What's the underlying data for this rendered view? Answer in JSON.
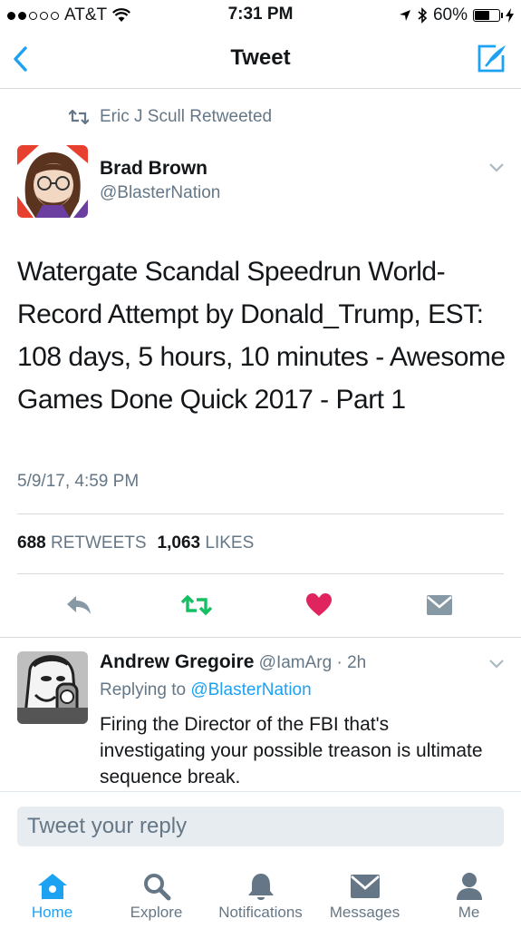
{
  "status_bar": {
    "carrier": "AT&T",
    "time": "7:31 PM",
    "battery": "60%",
    "battery_level": 0.6
  },
  "nav": {
    "title": "Tweet"
  },
  "tweet": {
    "retweeted_by": "Eric J Scull Retweeted",
    "author_name": "Brad Brown",
    "author_handle": "@BlasterNation",
    "text": "Watergate Scandal Speedrun World-Record Attempt by Donald_Trump, EST: 108 days, 5 hours, 10 minutes - Awesome Games Done Quick 2017 - Part 1",
    "timestamp": "5/9/17, 4:59 PM",
    "retweets_count": "688",
    "retweets_label": "RETWEETS",
    "likes_count": "1,063",
    "likes_label": "LIKES",
    "colors": {
      "retweet": "#17bf63",
      "like": "#e0245e",
      "action_gray": "#8899a6"
    }
  },
  "reply": {
    "author_name": "Andrew Gregoire",
    "author_handle": "@IamArg",
    "time": "· 2h",
    "replying_prefix": "Replying to",
    "replying_to": "@BlasterNation",
    "text": "Firing the Director of the FBI that's investigating your possible treason is ultimate sequence break."
  },
  "reply_box": {
    "placeholder": "Tweet your reply"
  },
  "tabs": [
    {
      "label": "Home",
      "icon": "home-icon",
      "active": true
    },
    {
      "label": "Explore",
      "icon": "search-icon",
      "active": false
    },
    {
      "label": "Notifications",
      "icon": "bell-icon",
      "active": false
    },
    {
      "label": "Messages",
      "icon": "envelope-icon",
      "active": false
    },
    {
      "label": "Me",
      "icon": "person-icon",
      "active": false
    }
  ],
  "accent_color": "#1da1f2"
}
